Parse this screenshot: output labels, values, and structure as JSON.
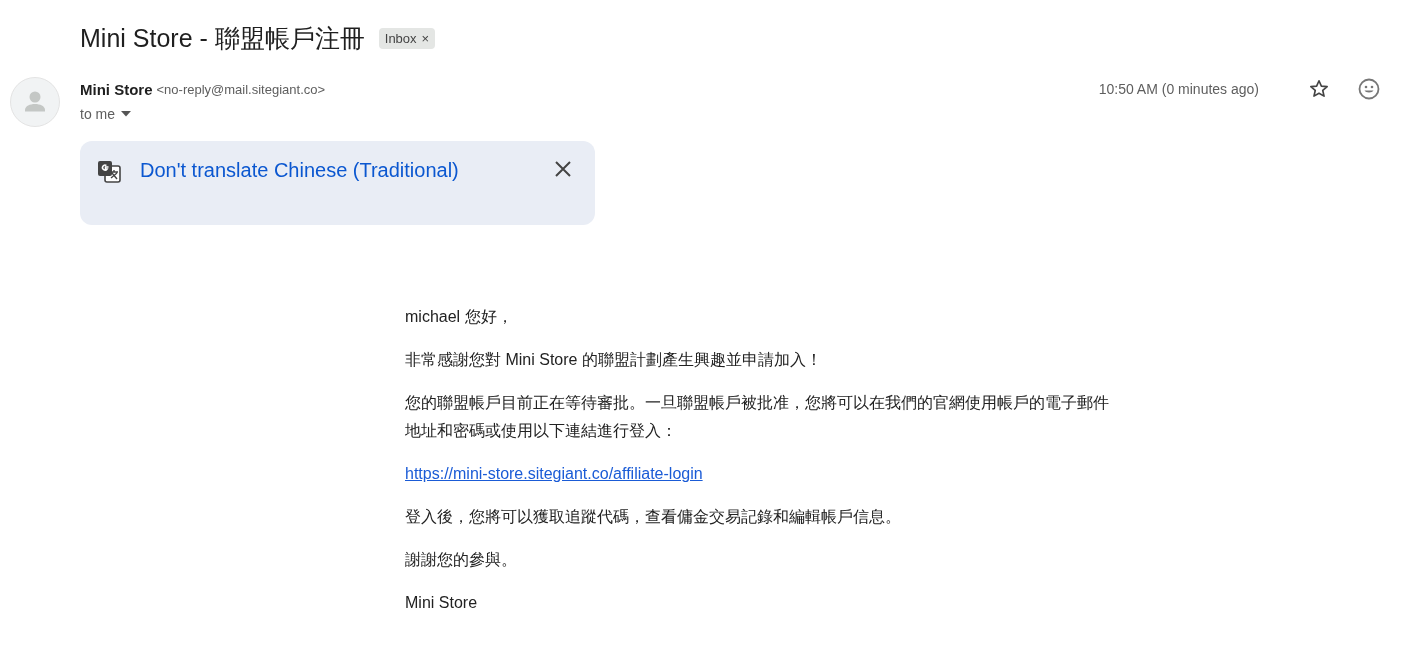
{
  "subject": "Mini Store - 聯盟帳戶注冊",
  "labels": [
    {
      "text": "Inbox",
      "close": "×"
    }
  ],
  "sender": {
    "name": "Mini Store",
    "address": "<no-reply@mail.sitegiant.co>",
    "recipient": "to me",
    "time": "10:50 AM (0 minutes ago)",
    "starred": false
  },
  "translate_banner": {
    "link": "Don't translate Chinese (Traditional)"
  },
  "body": [
    {
      "kind": "text",
      "text": "michael 您好，"
    },
    {
      "kind": "text",
      "text": "非常感謝您對 Mini Store 的聯盟計劃產生興趣並申請加入！"
    },
    {
      "kind": "text",
      "text": "您的聯盟帳戶目前正在等待審批。一旦聯盟帳戶被批准，您將可以在我們的官網使用帳戶的電子郵件地址和密碼或使用以下連結進行登入："
    },
    {
      "kind": "link",
      "text": "https://mini-store.sitegiant.co/affiliate-login"
    },
    {
      "kind": "text",
      "text": "登入後，您將可以獲取追蹤代碼，查看傭金交易記錄和編輯帳戶信息。"
    },
    {
      "kind": "text",
      "text": "謝謝您的參與。"
    },
    {
      "kind": "text",
      "text": "Mini Store"
    }
  ]
}
